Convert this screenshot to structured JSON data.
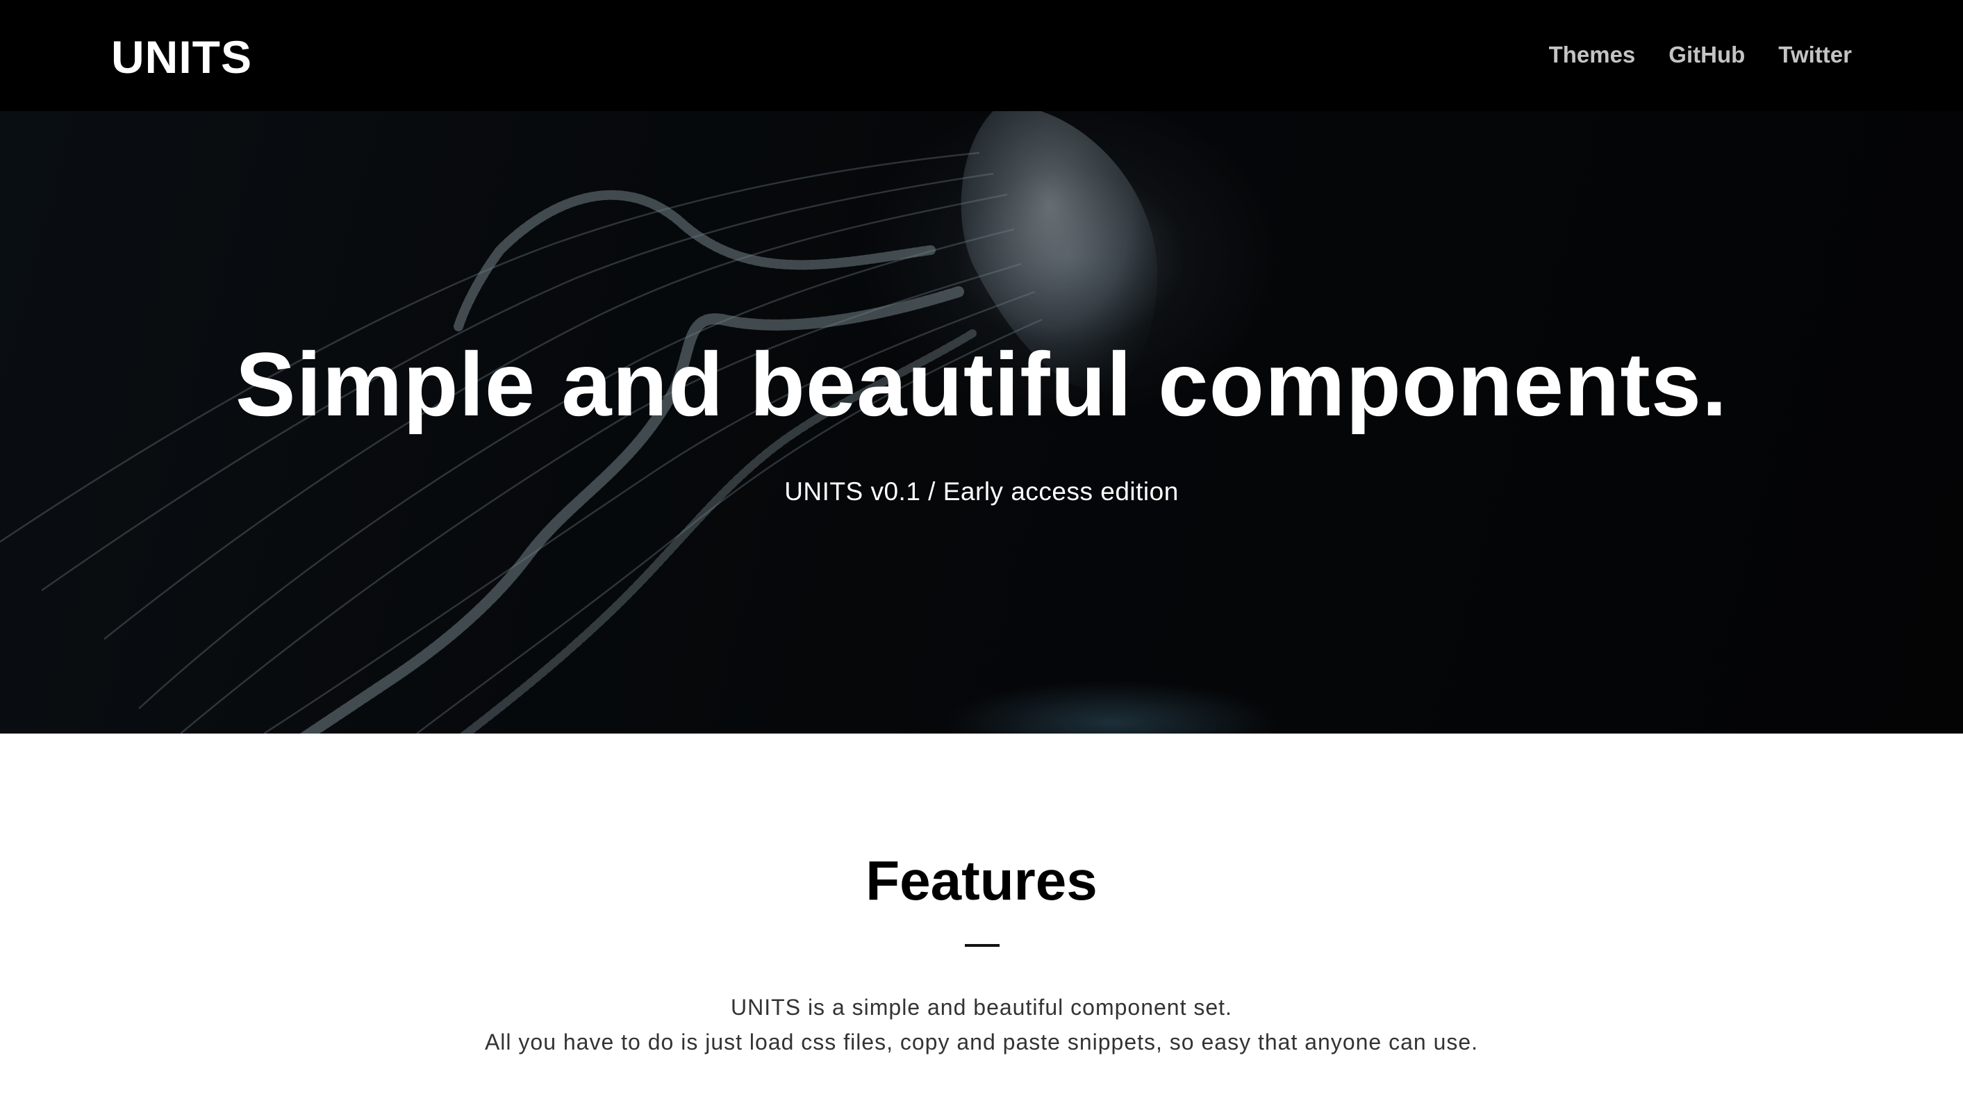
{
  "navbar": {
    "logo": "UNITS",
    "links": [
      {
        "label": "Themes"
      },
      {
        "label": "GitHub"
      },
      {
        "label": "Twitter"
      }
    ]
  },
  "hero": {
    "title": "Simple and beautiful components.",
    "subtitle": "UNITS v0.1 / Early access edition"
  },
  "features": {
    "title": "Features",
    "description_lines": [
      "UNITS is a simple and beautiful component set.",
      "All you have to do is just load css files, copy and paste snippets, so easy that anyone can use."
    ]
  },
  "colors": {
    "navbar_bg": "#000000",
    "nav_link": "#c4c4c4",
    "hero_text": "#ffffff",
    "body_bg": "#ffffff",
    "heading": "#000000",
    "body_text": "#333333"
  }
}
